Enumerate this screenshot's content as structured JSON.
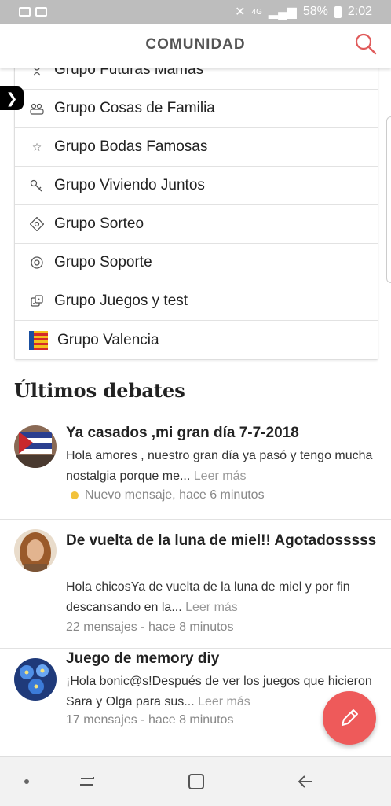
{
  "status_bar": {
    "battery": "58%",
    "time": "2:02",
    "signal": "4G"
  },
  "header": {
    "title": "COMUNIDAD",
    "search_icon": "search-icon",
    "accent_color": "#e05b5b"
  },
  "groups": [
    {
      "label": "Grupo Futuras Mamás",
      "icon": "baby-icon"
    },
    {
      "label": "Grupo Cosas de Familia",
      "icon": "family-icon"
    },
    {
      "label": "Grupo Bodas Famosas",
      "icon": "star-icon"
    },
    {
      "label": "Grupo Viviendo Juntos",
      "icon": "key-icon"
    },
    {
      "label": "Grupo Sorteo",
      "icon": "gift-icon"
    },
    {
      "label": "Grupo Soporte",
      "icon": "lifebuoy-icon"
    },
    {
      "label": "Grupo Juegos y test",
      "icon": "dice-icon"
    },
    {
      "label": "Grupo Valencia",
      "icon": "valencia-flag-icon"
    }
  ],
  "debates_section": {
    "title": "Últimos debates"
  },
  "debates": [
    {
      "title": "Ya casados ,mi gran día 7-7-2018",
      "body": "Hola amores , nuestro gran día ya pasó y tengo mucha nostalgia porque me...",
      "read_more": "Leer más",
      "meta": "Nuevo mensaje, hace 6 minutos",
      "new": true
    },
    {
      "title": "De vuelta de la luna de miel!! Agotadosssss",
      "body": "Hola chicosYa de vuelta de la luna de miel y por fin descansando en la...",
      "read_more": "Leer más",
      "meta": "22 mensajes - hace 8 minutos",
      "new": false
    },
    {
      "title": "Juego de memory diy",
      "body": "¡Hola bonic@s!Después de ver los juegos que hicieron Sara y Olga para sus...",
      "read_more": "Leer más",
      "meta": "17 mensajes - hace 8 minutos",
      "new": false
    }
  ],
  "fab": {
    "icon": "pencil-icon",
    "color": "#ee5a5a"
  },
  "nav": {
    "items": [
      "dot-icon",
      "recent-apps-icon",
      "home-icon",
      "back-icon"
    ]
  }
}
